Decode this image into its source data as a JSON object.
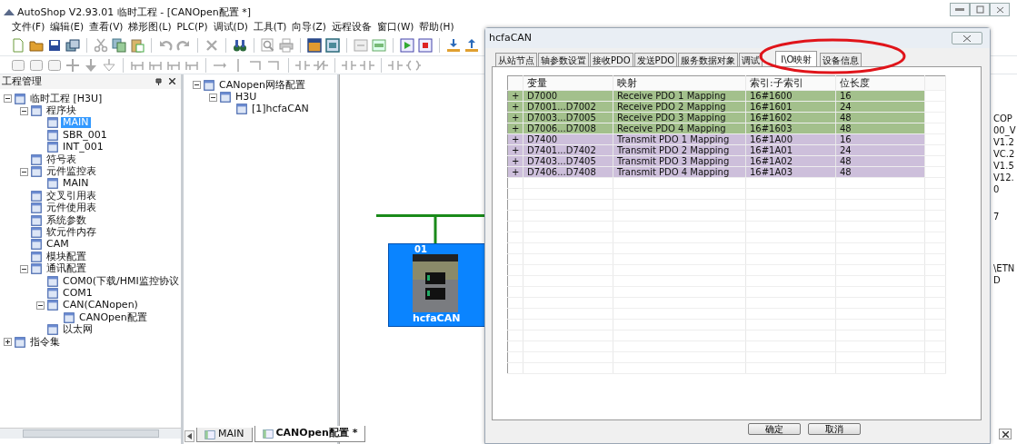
{
  "window": {
    "title": "AutoShop V2.93.01  临时工程 - [CANOpen配置 *]"
  },
  "menu": [
    "文件(F)",
    "编辑(E)",
    "查看(V)",
    "梯形图(L)",
    "PLC(P)",
    "调试(D)",
    "工具(T)",
    "向导(Z)",
    "远程设备",
    "窗口(W)",
    "帮助(H)"
  ],
  "project_panel": {
    "title": "工程管理",
    "tree": [
      {
        "label": "临时工程 [H3U]",
        "selected": false,
        "expanded": true,
        "children": [
          {
            "label": "程序块",
            "selected": false,
            "expanded": true,
            "children": [
              {
                "label": "MAIN",
                "selected": true
              },
              {
                "label": "SBR_001",
                "selected": false
              },
              {
                "label": "INT_001",
                "selected": false
              }
            ]
          },
          {
            "label": "符号表",
            "selected": false
          },
          {
            "label": "元件监控表",
            "selected": false,
            "expanded": true,
            "children": [
              {
                "label": "MAIN",
                "selected": false
              }
            ]
          },
          {
            "label": "交叉引用表",
            "selected": false
          },
          {
            "label": "元件使用表",
            "selected": false
          },
          {
            "label": "系统参数",
            "selected": false
          },
          {
            "label": "软元件内存",
            "selected": false
          },
          {
            "label": "CAM",
            "selected": false
          },
          {
            "label": "模块配置",
            "selected": false
          },
          {
            "label": "通讯配置",
            "selected": false,
            "expanded": true,
            "children": [
              {
                "label": "COM0(下载/HMI监控协议",
                "selected": false
              },
              {
                "label": "COM1",
                "selected": false
              },
              {
                "label": "CAN(CANopen)",
                "selected": false,
                "expanded": true,
                "children": [
                  {
                    "label": "CANOpen配置",
                    "selected": false
                  }
                ]
              },
              {
                "label": "以太网",
                "selected": false
              }
            ]
          }
        ]
      },
      {
        "label": "指令集",
        "selected": false,
        "expanded": false
      }
    ]
  },
  "network_tree": [
    {
      "label": "CANopen网络配置",
      "selected": false,
      "expanded": true,
      "children": [
        {
          "label": "H3U",
          "selected": false,
          "expanded": true,
          "children": [
            {
              "label": "[1]hcfaCAN",
              "selected": false
            }
          ]
        }
      ]
    }
  ],
  "canvas": {
    "device": {
      "address": "01",
      "name": "hcfaCAN"
    }
  },
  "document_tabs": [
    {
      "label": "MAIN",
      "selected": false
    },
    {
      "label": "CANOpen配置 *",
      "selected": true
    }
  ],
  "background_panel": {
    "lines": [
      "COP",
      "00_V",
      "V1.2",
      "VC.2",
      "V1.5",
      "V12.",
      "0",
      "7",
      "\\ETN",
      "D"
    ]
  },
  "dialog": {
    "title": "hcfaCAN",
    "tabs": [
      {
        "label": "从站节点",
        "selected": false
      },
      {
        "label": "轴参数设置",
        "selected": false
      },
      {
        "label": "接收PDO",
        "selected": false
      },
      {
        "label": "发送PDO",
        "selected": false
      },
      {
        "label": "服务数据对象",
        "selected": false
      },
      {
        "label": "调试",
        "selected": false
      },
      {
        "label": "I\\O映射",
        "selected": true
      },
      {
        "label": "设备信息",
        "selected": false
      }
    ],
    "table": {
      "columns": [
        "变量",
        "映射",
        "索引:子索引",
        "位长度"
      ],
      "rows": [
        {
          "expander": "+",
          "variable": "D7000",
          "mapping": "Receive PDO 1 Mapping",
          "index": "16#1600",
          "bit_length": "16",
          "color": "#a3c08c"
        },
        {
          "expander": "+",
          "variable": "D7001...D7002",
          "mapping": "Receive PDO 2 Mapping",
          "index": "16#1601",
          "bit_length": "24",
          "color": "#a3c08c"
        },
        {
          "expander": "+",
          "variable": "D7003...D7005",
          "mapping": "Receive PDO 3 Mapping",
          "index": "16#1602",
          "bit_length": "48",
          "color": "#a3c08c"
        },
        {
          "expander": "+",
          "variable": "D7006...D7008",
          "mapping": "Receive PDO 4 Mapping",
          "index": "16#1603",
          "bit_length": "48",
          "color": "#a3c08c"
        },
        {
          "expander": "+",
          "variable": "D7400",
          "mapping": "Transmit PDO 1 Mapping",
          "index": "16#1A00",
          "bit_length": "16",
          "color": "#cdbfdb"
        },
        {
          "expander": "+",
          "variable": "D7401...D7402",
          "mapping": "Transmit PDO 2 Mapping",
          "index": "16#1A01",
          "bit_length": "24",
          "color": "#cdbfdb"
        },
        {
          "expander": "+",
          "variable": "D7403...D7405",
          "mapping": "Transmit PDO 3 Mapping",
          "index": "16#1A02",
          "bit_length": "48",
          "color": "#cdbfdb"
        },
        {
          "expander": "+",
          "variable": "D7406...D7408",
          "mapping": "Transmit PDO 4 Mapping",
          "index": "16#1A03",
          "bit_length": "48",
          "color": "#cdbfdb"
        }
      ]
    },
    "buttons": [
      "确定",
      "取消"
    ]
  }
}
